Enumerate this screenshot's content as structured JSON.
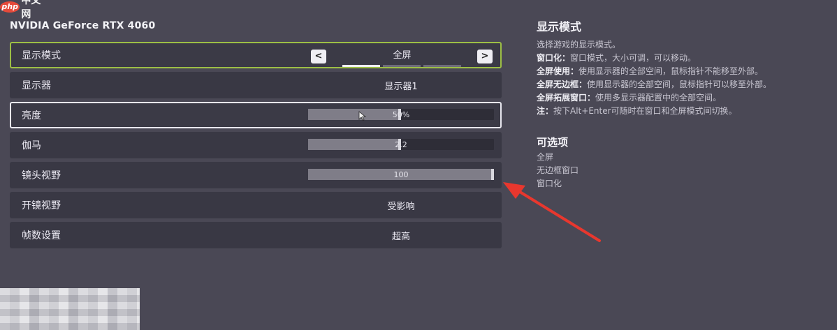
{
  "watermark": {
    "logo": "php",
    "text": "中文网"
  },
  "gpu_name": "NVIDIA GeForce RTX 4060",
  "settings": {
    "display_mode": {
      "label": "显示模式",
      "value": "全屏",
      "prev": "<",
      "next": ">",
      "segments": 3,
      "active_segment": 1
    },
    "monitor": {
      "label": "显示器",
      "value": "显示器1"
    },
    "brightness": {
      "label": "亮度",
      "value_text": "50%",
      "value": 0.5
    },
    "gamma": {
      "label": "伽马",
      "value_text": "2.2",
      "value": 0.5
    },
    "fov": {
      "label": "镜头视野",
      "value_text": "100",
      "value": 1.0
    },
    "scope_fov": {
      "label": "开镜视野",
      "value": "受影响"
    },
    "framerate": {
      "label": "帧数设置",
      "value": "超高"
    }
  },
  "info": {
    "title": "显示模式",
    "intro": "选择游戏的显示模式。",
    "lines": [
      {
        "key": "窗口化：",
        "text": "窗口模式，大小可调，可以移动。"
      },
      {
        "key": "全屏使用：",
        "text": "使用显示器的全部空间，鼠标指针不能移至外部。"
      },
      {
        "key": "全屏无边框：",
        "text": "使用显示器的全部空间，鼠标指针可以移至外部。"
      },
      {
        "key": "全屏拓展窗口：",
        "text": "使用多显示器配置中的全部空间。"
      },
      {
        "key": "注：",
        "text": "按下Alt+Enter可随时在窗口和全屏模式间切换。"
      }
    ],
    "options_title": "可选项",
    "options": [
      "全屏",
      "无边框窗口",
      "窗口化"
    ]
  },
  "colors": {
    "accent_selected": "#9dbf45",
    "annotation_arrow": "#e8372e",
    "background": "#4a4855"
  }
}
